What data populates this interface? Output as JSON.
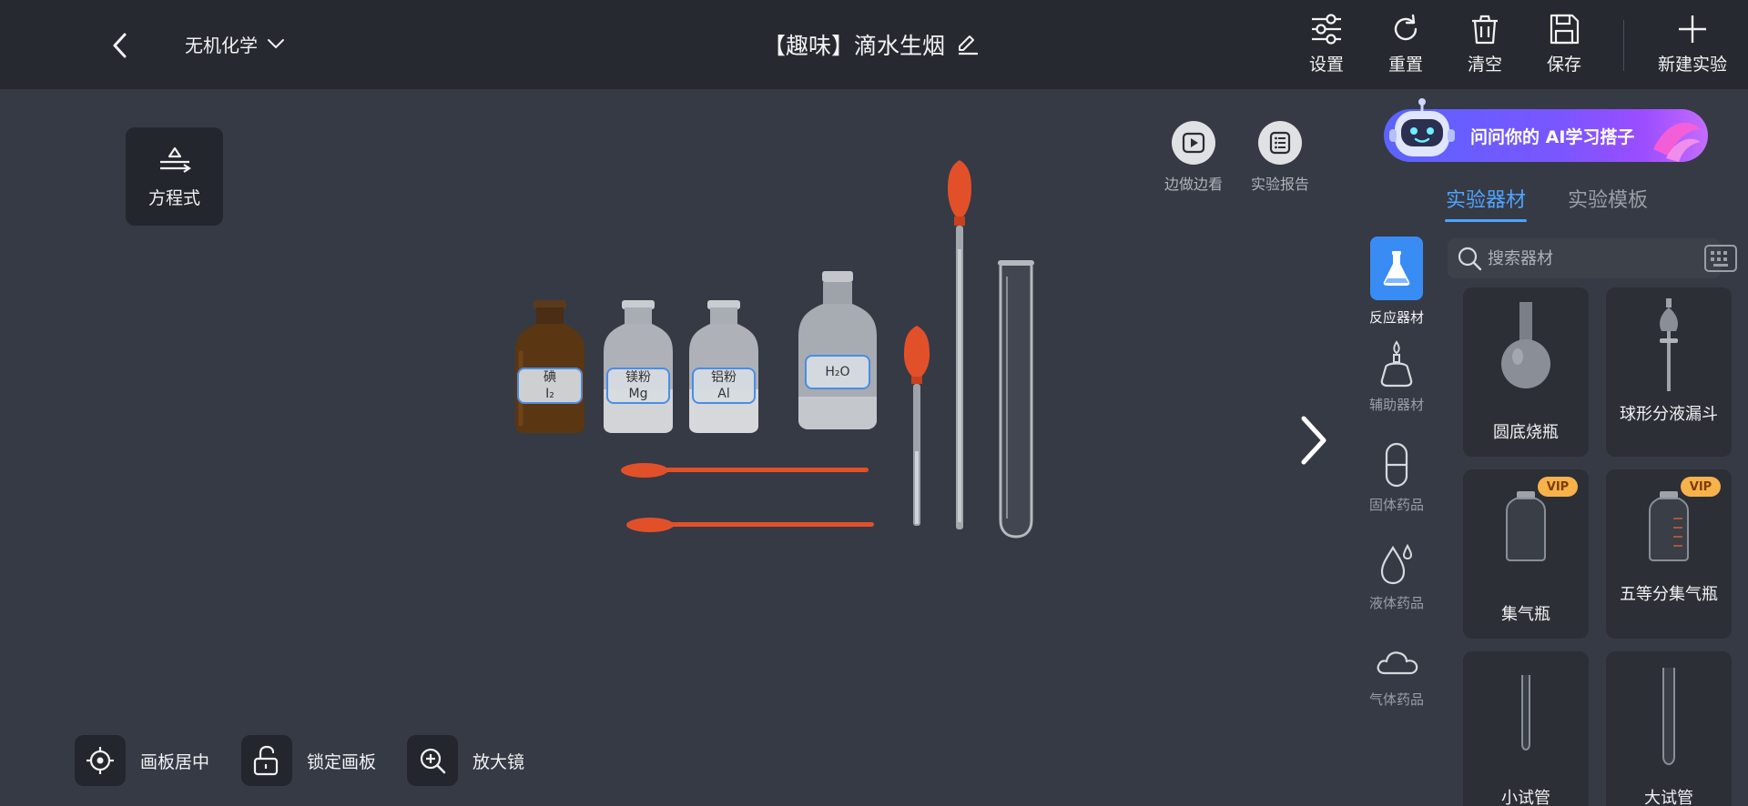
{
  "header": {
    "back_icon": "chevron-left-icon",
    "subject": "无机化学",
    "title": "【趣味】滴水生烟",
    "tools": {
      "settings": "设置",
      "reset": "重置",
      "clear": "清空",
      "save": "保存",
      "new_experiment": "新建实验"
    }
  },
  "equation_button": "方程式",
  "canvas_tools": {
    "watch_while_doing": "边做边看",
    "report": "实验报告"
  },
  "bottom_tools": {
    "center_canvas": "画板居中",
    "lock_canvas": "锁定画板",
    "magnifier": "放大镜"
  },
  "bench": {
    "iodine": {
      "name": "碘",
      "formula": "I₂"
    },
    "magnesium": {
      "name": "镁粉",
      "formula": "Mg"
    },
    "aluminum": {
      "name": "铝粉",
      "formula": "Al"
    },
    "water": {
      "formula": "H₂O"
    }
  },
  "right_panel": {
    "ai_banner": "问问你的 AI学习搭子",
    "tabs": [
      "实验器材",
      "实验模板"
    ],
    "active_tab": 0,
    "search_placeholder": "搜索器材",
    "categories": [
      "反应器材",
      "辅助器材",
      "固体药品",
      "液体药品",
      "气体药品"
    ],
    "active_category": 0,
    "items": [
      {
        "name": "圆底烧瓶",
        "vip": false,
        "icon": "round-bottom-flask-icon"
      },
      {
        "name": "球形分液漏斗",
        "vip": false,
        "icon": "separatory-funnel-icon"
      },
      {
        "name": "集气瓶",
        "vip": true,
        "icon": "gas-jar-icon"
      },
      {
        "name": "五等分集气瓶",
        "vip": true,
        "icon": "graduated-gas-jar-icon"
      },
      {
        "name": "小试管",
        "vip": false,
        "icon": "small-test-tube-icon"
      },
      {
        "name": "大试管",
        "vip": false,
        "icon": "large-test-tube-icon"
      }
    ],
    "vip_label": "VIP"
  },
  "colors": {
    "accent": "#4fa3ff",
    "topbar": "#26292f",
    "canvas": "#363a44",
    "vip": "#f7b24a",
    "rubber": "#e2502a"
  }
}
